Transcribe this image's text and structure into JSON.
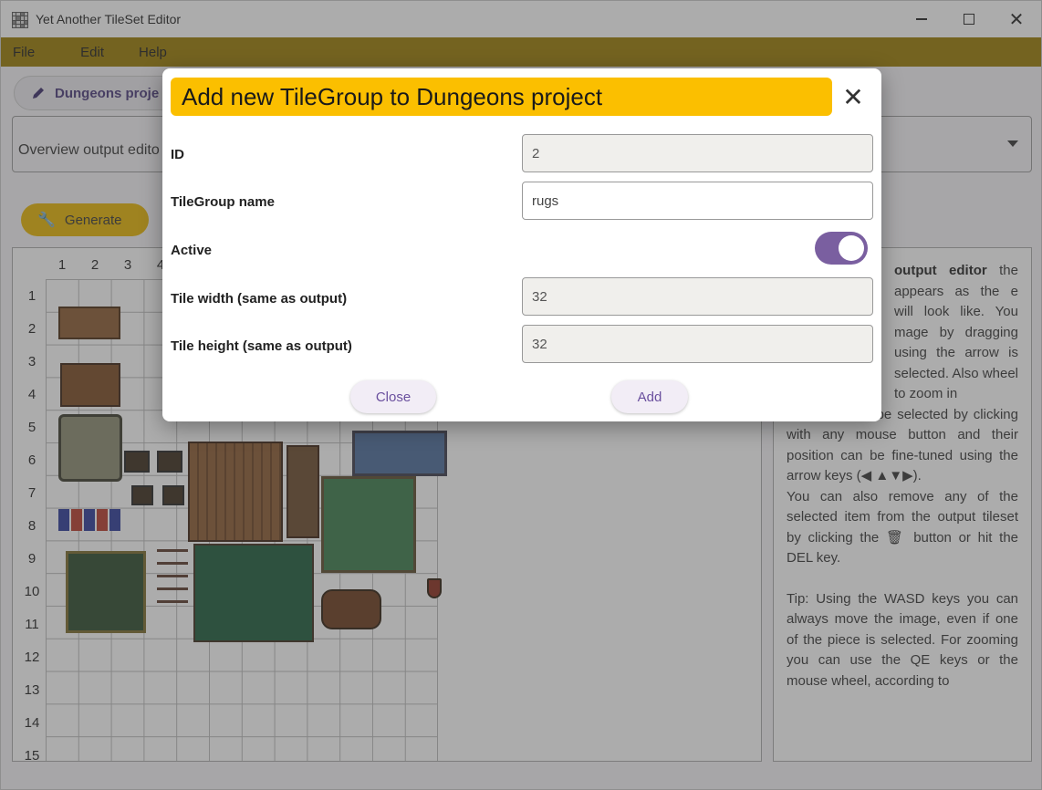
{
  "window": {
    "title": "Yet Another TileSet Editor",
    "controls": {
      "minimize": "—",
      "maximize": "",
      "close": "✕"
    }
  },
  "menu": {
    "items": [
      "File",
      "Edit",
      "Help"
    ]
  },
  "toolbar": {
    "project_chip": "Dungeons proje",
    "dropdown_value": "Overview output edito",
    "generate_label": "Generate"
  },
  "grid": {
    "columns": [
      "1",
      "2",
      "3",
      "4"
    ],
    "rows": [
      "1",
      "2",
      "3",
      "4",
      "5",
      "6",
      "7",
      "8",
      "9",
      "10",
      "11",
      "12",
      "13",
      "14",
      "15"
    ]
  },
  "info": {
    "p1_bold": "output editor",
    "p1_text": " the appears as the e will look like. You mage by dragging using the arrow is selected. Also wheel to zoom in",
    "p2": "Elements can be selected by clicking with any mouse button and their position can be fine-tuned using the arrow keys (◀ ▲▼▶).",
    "p3": "You can also remove any of the selected item from the output tileset by clicking the 🗑 button or hit the DEL key.",
    "p4": "Tip: Using the WASD keys you can always move the image, even if one of the piece is selected. For zooming you can use the QE keys or the mouse wheel, according to"
  },
  "dialog": {
    "title": "Add new TileGroup to Dungeons project",
    "close_icon": "✕",
    "fields": {
      "id_label": "ID",
      "id_value": "2",
      "name_label": "TileGroup name",
      "name_value": "rugs",
      "active_label": "Active",
      "active": true,
      "width_label": "Tile width (same as output)",
      "width_value": "32",
      "height_label": "Tile height (same as output)",
      "height_value": "32"
    },
    "buttons": {
      "close": "Close",
      "add": "Add"
    }
  },
  "colors": {
    "menubar": "#9a7a00",
    "title_bg": "#fbbf00",
    "accent": "#7a5fa0",
    "generate": "#e8b400"
  }
}
